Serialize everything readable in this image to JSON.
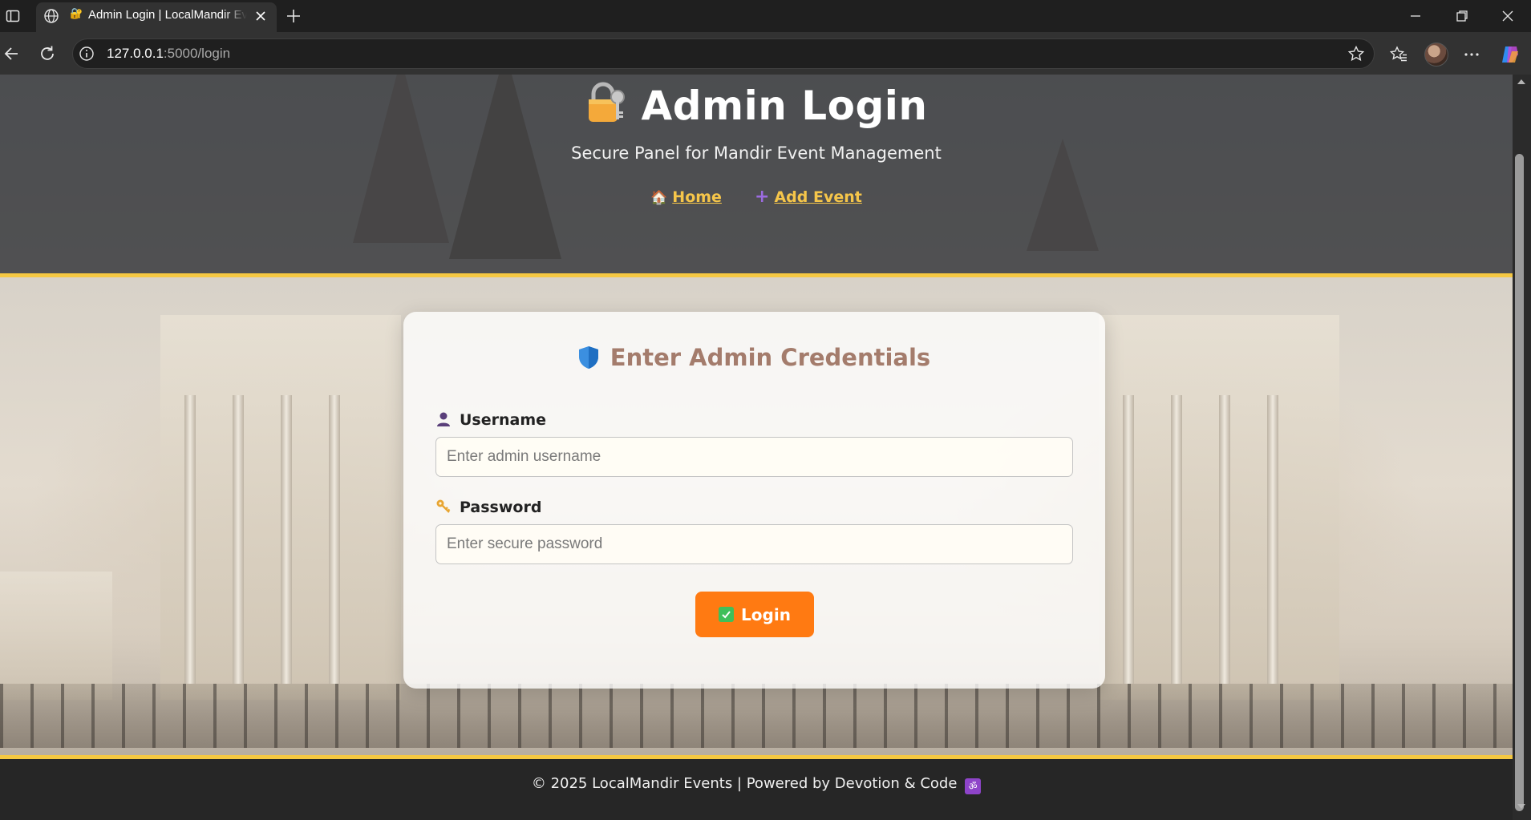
{
  "browser": {
    "tab_title": "Admin Login | LocalMandir Events",
    "url_host": "127.0.0.1",
    "url_rest": ":5000/login"
  },
  "header": {
    "title": "Admin Login",
    "subtitle": "Secure Panel for Mandir Event Management",
    "nav": [
      {
        "icon": "house-icon",
        "label": "Home"
      },
      {
        "icon": "plus-icon",
        "label": "Add Event"
      }
    ]
  },
  "login_form": {
    "heading": "Enter Admin Credentials",
    "username_label": "Username",
    "username_placeholder": "Enter admin username",
    "password_label": "Password",
    "password_placeholder": "Enter secure password",
    "submit_label": "Login"
  },
  "footer": {
    "text": "© 2025 LocalMandir Events | Powered by Devotion & Code",
    "om_symbol": "ॐ"
  },
  "colors": {
    "accent_yellow": "#f5c842",
    "button_orange": "#ff7a12",
    "heading_brown": "#a47c6c"
  }
}
